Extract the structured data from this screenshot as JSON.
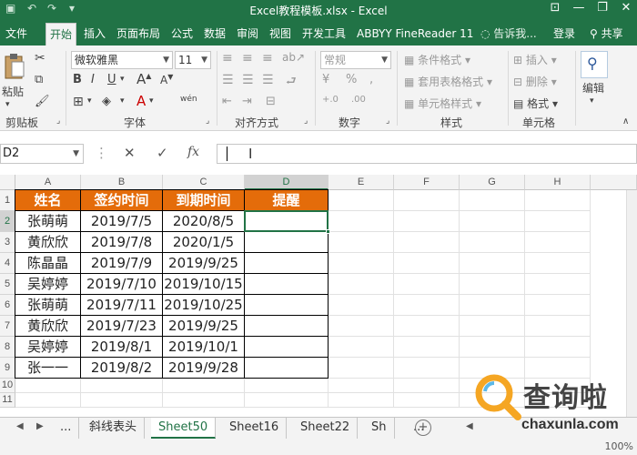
{
  "titlebar": {
    "title": "Excel教程模板.xlsx - Excel"
  },
  "tabs": {
    "file": "文件",
    "home": "开始",
    "insert": "插入",
    "layout": "页面布局",
    "formulas": "公式",
    "data": "数据",
    "review": "审阅",
    "view": "视图",
    "developer": "开发工具",
    "abbyy": "ABBYY FineReader 11",
    "tellme": "告诉我...",
    "login": "登录",
    "share": "共享"
  },
  "ribbon": {
    "paste": "粘贴",
    "font_name": "微软雅黑",
    "font_size": "11",
    "number_format": "常规",
    "conditional": "条件格式",
    "table_format": "套用表格格式",
    "cell_style": "单元格样式",
    "insert": "插入",
    "delete": "删除",
    "format": "格式",
    "edit": "编辑",
    "groups": {
      "clipboard": "剪贴板",
      "font": "字体",
      "align": "对齐方式",
      "number": "数字",
      "style": "样式",
      "cells": "单元格"
    }
  },
  "formula_bar": {
    "name_box": "D2",
    "fx": "fx",
    "value": ""
  },
  "columns": [
    "A",
    "B",
    "C",
    "D",
    "E",
    "F",
    "G",
    "H"
  ],
  "rows": [
    "1",
    "2",
    "3",
    "4",
    "5",
    "6",
    "7",
    "8",
    "9",
    "10",
    "11"
  ],
  "table": {
    "headers": [
      "姓名",
      "签约时间",
      "到期时间",
      "提醒"
    ],
    "rows": [
      [
        "张萌萌",
        "2019/7/5",
        "2020/8/5",
        ""
      ],
      [
        "黄欣欣",
        "2019/7/8",
        "2020/1/5",
        ""
      ],
      [
        "陈晶晶",
        "2019/7/9",
        "2019/9/25",
        ""
      ],
      [
        "吴婷婷",
        "2019/7/10",
        "2019/10/15",
        ""
      ],
      [
        "张萌萌",
        "2019/7/11",
        "2019/10/25",
        ""
      ],
      [
        "黄欣欣",
        "2019/7/23",
        "2019/9/25",
        ""
      ],
      [
        "吴婷婷",
        "2019/8/1",
        "2019/10/1",
        ""
      ],
      [
        "张一一",
        "2019/8/2",
        "2019/9/28",
        ""
      ]
    ]
  },
  "sheets": {
    "ellipsis": "...",
    "tabs": [
      "斜线表头",
      "Sheet50",
      "Sheet16",
      "Sheet22",
      "Sh"
    ],
    "active": "Sheet50"
  },
  "status": {
    "zoom": "100%"
  },
  "watermark": {
    "text": "查询啦",
    "url": "chaxunla.com"
  },
  "colors": {
    "excel_green": "#217346",
    "header_orange": "#e46c0a"
  }
}
